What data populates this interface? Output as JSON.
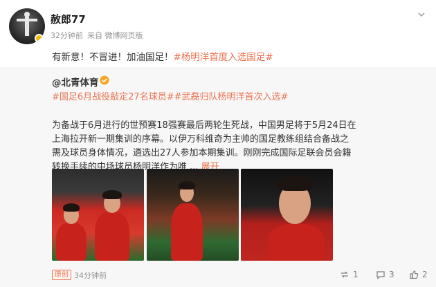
{
  "post": {
    "username": "赦郎77",
    "time": "32分钟前",
    "source": "来自 微博网页版",
    "text": "有新意！不冒进！加油国足！",
    "hashtag": "#杨明洋首度入选国足#"
  },
  "repost": {
    "author": "@北青体育",
    "tags": "#国足6月战役敲定27名球员##武磊归队杨明洋首次入选#",
    "body": "为备战于6月进行的世预赛18强赛最后两轮生死战，中国男足将于5月24日在上海拉开新一期集训的序幕。以伊万科维奇为主帅的国足教练组结合备战之需及球员身体情况，遴选出27人参加本期集训。刚刚完成国际足联会员会籍转换手续的中场球员杨明洋作为唯 ...",
    "expand_label": "展开",
    "footer": {
      "badge": "原创",
      "time": "34分钟前",
      "repost_count": "1",
      "comment_count": "3",
      "like_count": "2"
    }
  },
  "icons": {
    "more": "chevron-down-icon",
    "verify": "verified-badge-icon",
    "repost": "repost-icon",
    "comment": "comment-icon",
    "like": "like-icon"
  },
  "colors": {
    "accent": "#eb7350",
    "repost_bg": "#f7f7f7",
    "verify": "#f5a623"
  }
}
